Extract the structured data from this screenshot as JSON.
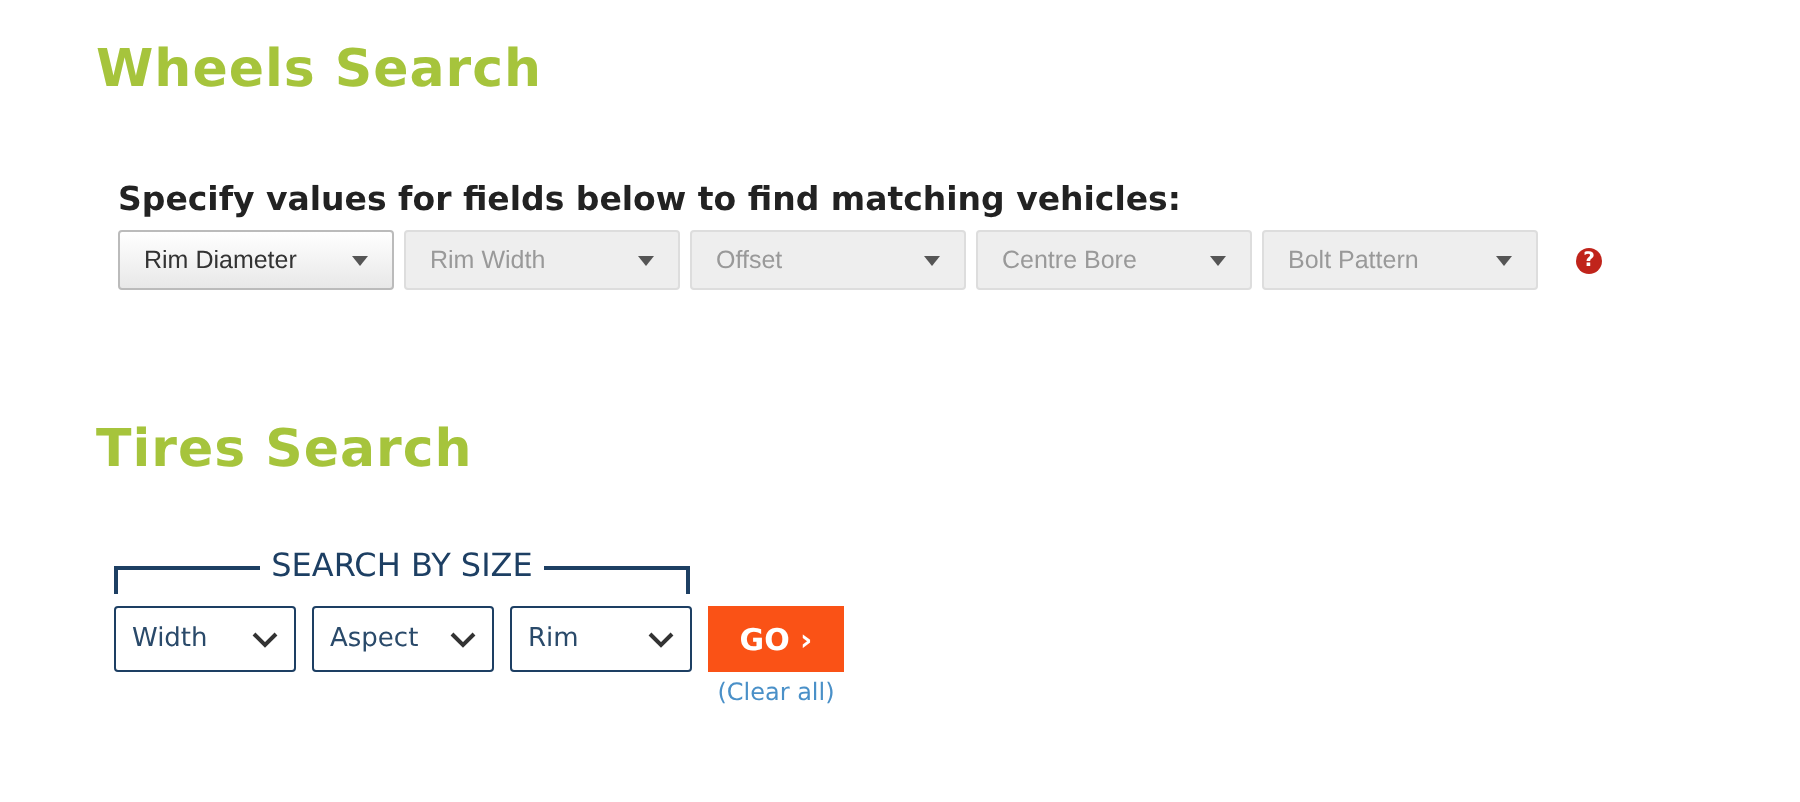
{
  "wheels": {
    "title": "Wheels Search",
    "prompt": "Specify values for fields below to find matching vehicles:",
    "dropdowns": [
      {
        "label": "Rim Diameter",
        "disabled": false
      },
      {
        "label": "Rim Width",
        "disabled": true
      },
      {
        "label": "Offset",
        "disabled": true
      },
      {
        "label": "Centre Bore",
        "disabled": true
      },
      {
        "label": "Bolt Pattern",
        "disabled": true
      }
    ],
    "help_icon": "?"
  },
  "tires": {
    "title": "Tires Search",
    "group_label": "SEARCH BY SIZE",
    "selects": [
      {
        "label": "Width"
      },
      {
        "label": "Aspect"
      },
      {
        "label": "Rim"
      }
    ],
    "go_button": "GO ›",
    "clear_link": "(Clear all)"
  }
}
